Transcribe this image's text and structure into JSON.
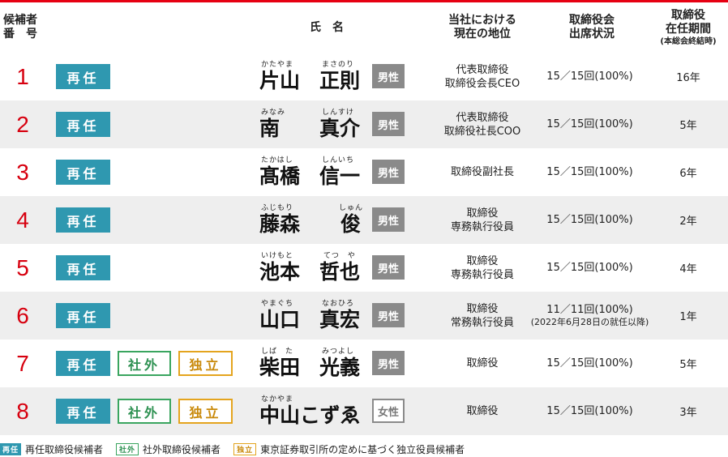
{
  "header": {
    "number_line1": "候補者",
    "number_line2": "番　号",
    "name": "氏名",
    "position_line1": "当社における",
    "position_line2": "現在の地位",
    "attendance_line1": "取締役会",
    "attendance_line2": "出席状況",
    "tenure_line1": "取締役",
    "tenure_line2": "在任期間",
    "tenure_note": "(本総会終結時)"
  },
  "badges": {
    "reappoint": "再任",
    "outside": "社外",
    "independent": "独立"
  },
  "candidates": [
    {
      "number": "1",
      "family_kanji": "片山",
      "family_ruby": "かたやま",
      "given_kanji": "正則",
      "given_ruby": "まさのり",
      "gender": "男性",
      "position_line1": "代表取締役",
      "position_line2": "取締役会長CEO",
      "attendance": "15／15回(100%)",
      "attendance_note": "",
      "tenure": "16年"
    },
    {
      "number": "2",
      "family_kanji": "南",
      "family_ruby": "みなみ",
      "given_kanji": "真介",
      "given_ruby": "しんすけ",
      "gender": "男性",
      "position_line1": "代表取締役",
      "position_line2": "取締役社長COO",
      "attendance": "15／15回(100%)",
      "attendance_note": "",
      "tenure": "5年"
    },
    {
      "number": "3",
      "family_kanji": "髙橋",
      "family_ruby": "たかはし",
      "given_kanji": "信一",
      "given_ruby": "しんいち",
      "gender": "男性",
      "position_line1": "取締役副社長",
      "position_line2": "",
      "attendance": "15／15回(100%)",
      "attendance_note": "",
      "tenure": "6年"
    },
    {
      "number": "4",
      "family_kanji": "藤森",
      "family_ruby": "ふじもり",
      "given_kanji": "俊",
      "given_ruby": "しゅん",
      "gender": "男性",
      "position_line1": "取締役",
      "position_line2": "専務執行役員",
      "attendance": "15／15回(100%)",
      "attendance_note": "",
      "tenure": "2年"
    },
    {
      "number": "5",
      "family_kanji": "池本",
      "family_ruby": "いけもと",
      "given_kanji": "哲也",
      "given_ruby": "てつ　や",
      "gender": "男性",
      "position_line1": "取締役",
      "position_line2": "専務執行役員",
      "attendance": "15／15回(100%)",
      "attendance_note": "",
      "tenure": "4年"
    },
    {
      "number": "6",
      "family_kanji": "山口",
      "family_ruby": "やまぐち",
      "given_kanji": "真宏",
      "given_ruby": "なおひろ",
      "gender": "男性",
      "position_line1": "取締役",
      "position_line2": "常務執行役員",
      "attendance": "11／11回(100%)",
      "attendance_note": "(2022年6月28日の就任以降)",
      "tenure": "1年"
    },
    {
      "number": "7",
      "family_kanji": "柴田",
      "family_ruby": "しば　た",
      "given_kanji": "光義",
      "given_ruby": "みつよし",
      "gender": "男性",
      "position_line1": "取締役",
      "position_line2": "",
      "attendance": "15／15回(100%)",
      "attendance_note": "",
      "tenure": "5年"
    },
    {
      "number": "8",
      "family_kanji": "中山こずゑ",
      "family_ruby": "なかやま",
      "given_kanji": "",
      "given_ruby": "",
      "gender": "女性",
      "position_line1": "取締役",
      "position_line2": "",
      "attendance": "15／15回(100%)",
      "attendance_note": "",
      "tenure": "3年"
    }
  ],
  "legend": {
    "reappoint_text": "再任取締役候補者",
    "outside_text": "社外取締役候補者",
    "independent_text": "東京証券取引所の定めに基づく独立役員候補者"
  },
  "colors": {
    "accent_red": "#e60012",
    "reappoint_badge": "#2f98b0",
    "outside_badge": "#3aa55f",
    "independent_badge": "#e4a41e",
    "male_badge": "#8a8a8a"
  }
}
